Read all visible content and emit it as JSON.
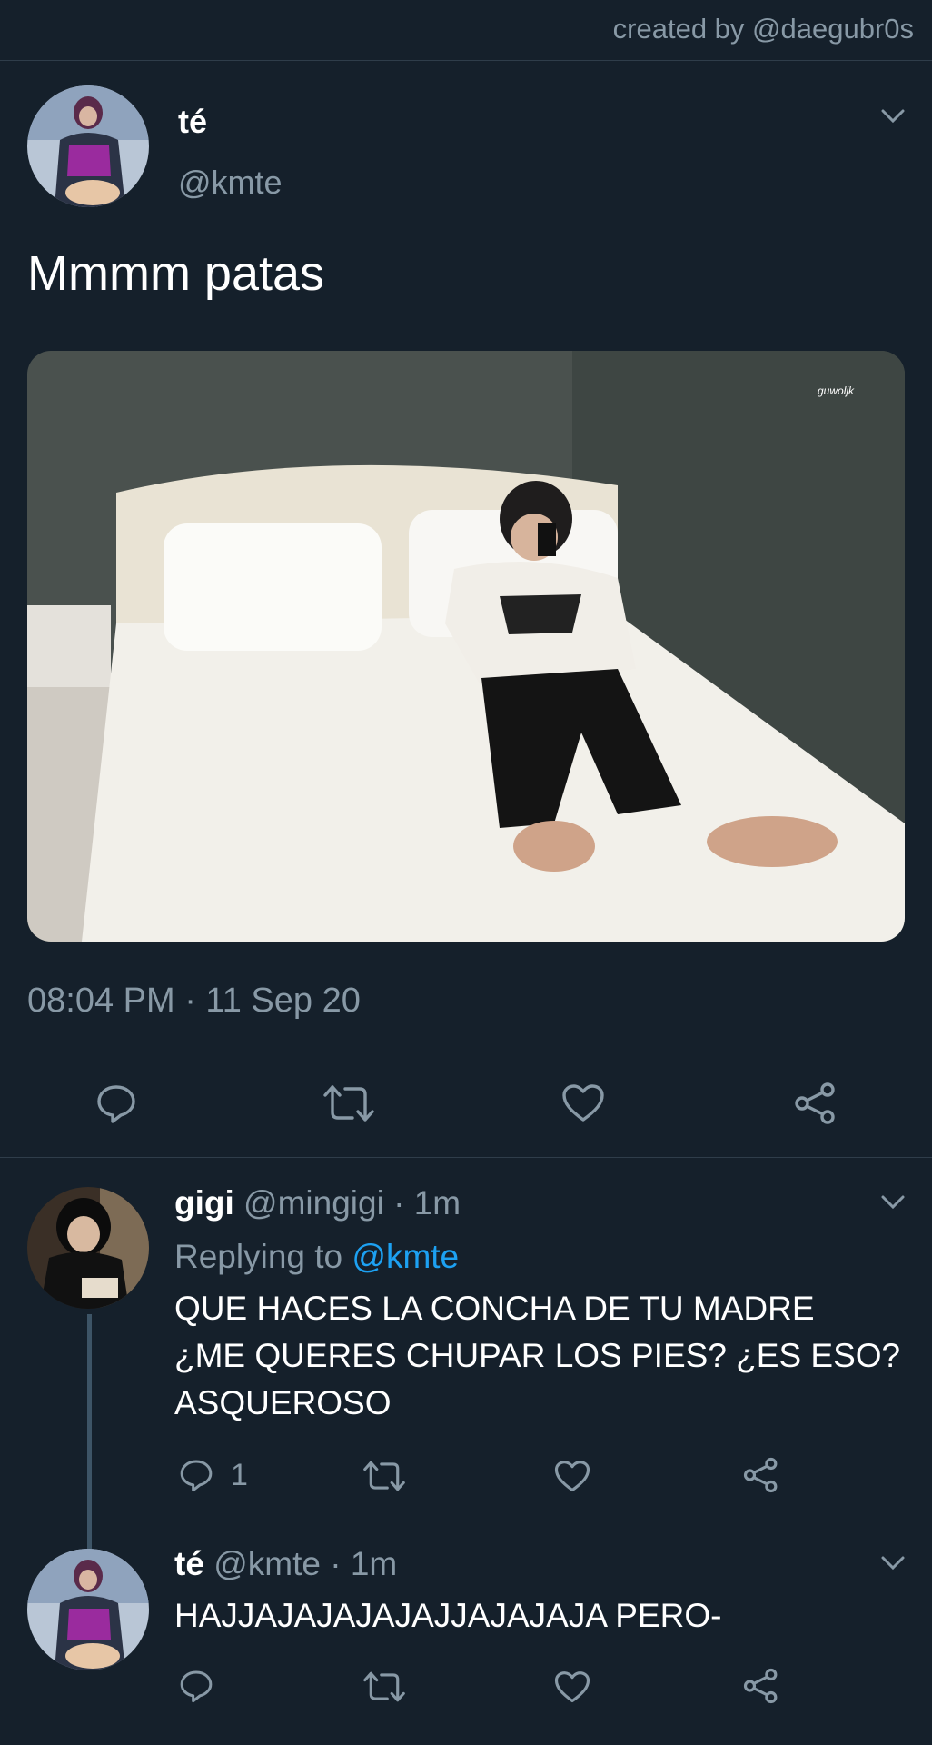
{
  "header": {
    "credit": "created by @daegubr0s"
  },
  "main_tweet": {
    "name": "té",
    "handle": "@kmte",
    "text": "Mmmm patas",
    "media_watermark": "guwoljk",
    "timestamp": "08:04 PM · 11 Sep 20"
  },
  "replies": [
    {
      "name": "gigi",
      "handle": "@mingigi",
      "dot_time": "· 1m",
      "replying_prefix": "Replying to",
      "replying_to": "@kmte",
      "lines": [
        "QUE HACES LA CONCHA DE TU MADRE",
        "¿ME QUERES CHUPAR LOS PIES? ¿ES ESO?",
        "ASQUEROSO"
      ],
      "reply_count": "1"
    },
    {
      "name": "té",
      "handle": "@kmte",
      "dot_time": "· 1m",
      "lines": [
        "HAJJAJAJAJAJAJJAJAJAJA PERO-"
      ]
    }
  ],
  "icons": {
    "reply": "reply-icon",
    "retweet": "retweet-icon",
    "like": "heart-icon",
    "share": "share-icon",
    "more": "chevron-down-icon"
  },
  "colors": {
    "background": "#15202b",
    "muted": "#8899a6",
    "link": "#1da1f2",
    "divider": "#2f3d4a"
  }
}
